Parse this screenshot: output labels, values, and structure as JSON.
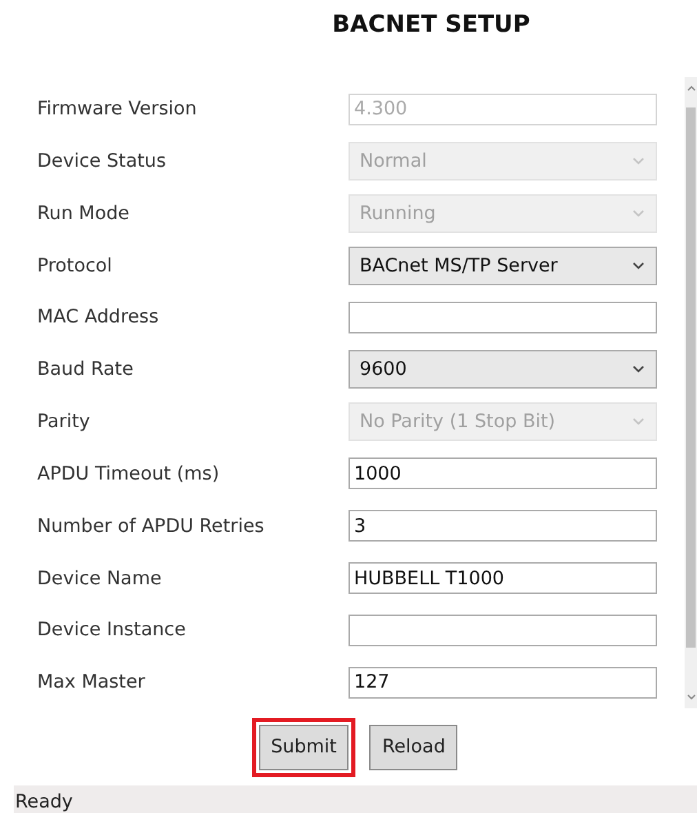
{
  "title": "BACNET SETUP",
  "fields": [
    {
      "label": "Firmware Version",
      "kind": "text",
      "value": "4.300",
      "disabled": true
    },
    {
      "label": "Device Status",
      "kind": "select",
      "value": "Normal",
      "disabled": true
    },
    {
      "label": "Run Mode",
      "kind": "select",
      "value": "Running",
      "disabled": true
    },
    {
      "label": "Protocol",
      "kind": "select",
      "value": "BACnet MS/TP Server",
      "disabled": false
    },
    {
      "label": "MAC Address",
      "kind": "text",
      "disabled": false
    },
    {
      "label": "Baud Rate",
      "kind": "select",
      "value": "9600",
      "disabled": false
    },
    {
      "label": "Parity",
      "kind": "select",
      "value": "No Parity (1 Stop Bit)",
      "disabled": true
    },
    {
      "label": "APDU Timeout (ms)",
      "kind": "text",
      "value": "1000",
      "disabled": false
    },
    {
      "label": "Number of APDU Retries",
      "kind": "text",
      "value": "3",
      "disabled": false
    },
    {
      "label": "Device Name",
      "kind": "text",
      "value": "HUBBELL T1000",
      "disabled": false
    },
    {
      "label": "Device Instance",
      "kind": "text",
      "disabled": false
    },
    {
      "label": "Max Master",
      "kind": "text",
      "value": "127",
      "disabled": false
    }
  ],
  "buttons": [
    {
      "label": "Submit",
      "highlighted": true
    },
    {
      "label": "Reload",
      "highlighted": false
    }
  ],
  "status_bar": "Ready"
}
